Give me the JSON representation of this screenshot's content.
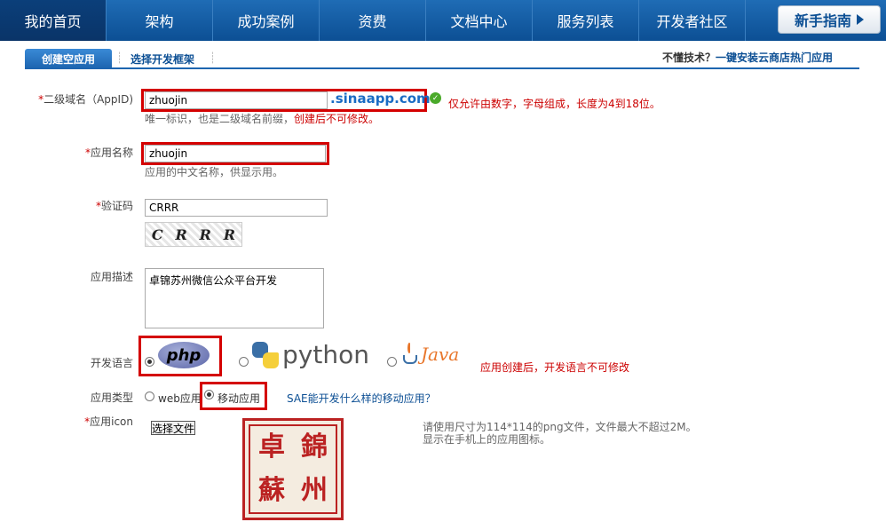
{
  "nav": {
    "items": [
      "我的首页",
      "架构",
      "成功案例",
      "资费",
      "文档中心",
      "服务列表",
      "开发者社区"
    ],
    "guide": "新手指南"
  },
  "subnav": {
    "active": "创建空应用",
    "other": "选择开发框架",
    "right_prefix": "不懂技术？",
    "right_link": "一键安装云商店热门应用"
  },
  "form": {
    "appid": {
      "label": "二级域名（AppID)",
      "value": "zhuojin",
      "suffix": ".sinaapp.com",
      "rule": "仅允许由数字，字母组成，长度为4到18位。",
      "hint": "唯一标识，也是二级域名前缀，",
      "hint_red": "创建后不可修改。"
    },
    "name": {
      "label": "应用名称",
      "value": "zhuojin",
      "hint": "应用的中文名称，供显示用。"
    },
    "captcha": {
      "label": "验证码",
      "value": "CRRR",
      "image_chars": [
        "C",
        "R",
        "R",
        "R"
      ]
    },
    "desc": {
      "label": "应用描述",
      "value": "卓锦苏州微信公众平台开发"
    },
    "lang": {
      "label": "开发语言",
      "options": [
        "php",
        "python",
        "Java"
      ],
      "selected": "php",
      "note": "应用创建后，开发语言不可修改"
    },
    "type": {
      "label": "应用类型",
      "options": [
        "web应用",
        "移动应用"
      ],
      "selected": "移动应用",
      "link": "SAE能开发什么样的移动应用？"
    },
    "icon": {
      "label": "应用icon",
      "button": "选择文件",
      "hint1": "请使用尺寸为114*114的png文件，文件最大不超过2M。",
      "hint2": "显示在手机上的应用图标。",
      "seal_chars": [
        "卓",
        "錦",
        "蘇",
        "州"
      ]
    }
  }
}
